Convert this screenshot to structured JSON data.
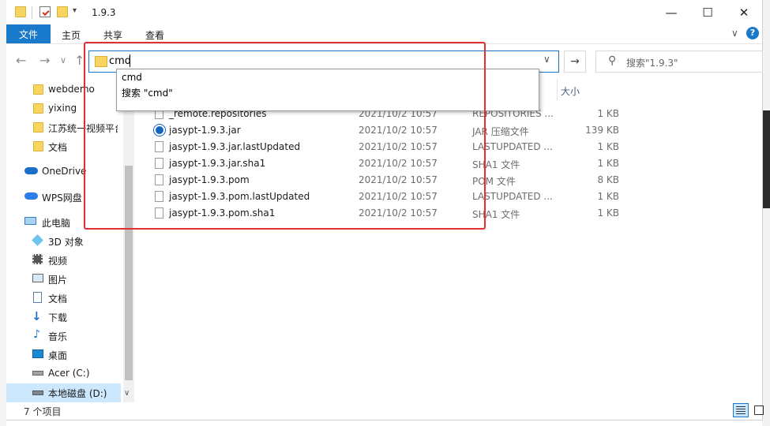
{
  "window": {
    "title": "1.9.3",
    "controls": {
      "minimize": "—",
      "maximize": "☐",
      "close": "✕"
    }
  },
  "ribbon": {
    "tabs": [
      "文件",
      "主页",
      "共享",
      "查看"
    ],
    "help": "?",
    "expand": "∨"
  },
  "nav": {
    "back": "←",
    "forward": "→",
    "recent": "∨",
    "up": "↑",
    "address_value": "cmd",
    "go": "→",
    "search_placeholder": "搜索\"1.9.3\""
  },
  "autocomplete": {
    "items": [
      "cmd",
      "搜索 \"cmd\""
    ]
  },
  "columns": {
    "size": "大小"
  },
  "sidebar": {
    "items": [
      {
        "label": "webdemo",
        "icon": "folder-icon"
      },
      {
        "label": "yixing",
        "icon": "folder-icon"
      },
      {
        "label": "江苏统一视频平台",
        "icon": "folder-icon"
      },
      {
        "label": "文档",
        "icon": "folder-icon"
      },
      {
        "label": "OneDrive",
        "icon": "cloud-icon"
      },
      {
        "label": "WPS网盘",
        "icon": "cloud-icon"
      },
      {
        "label": "此电脑",
        "icon": "computer-icon"
      },
      {
        "label": "3D 对象",
        "icon": "cube-icon"
      },
      {
        "label": "视频",
        "icon": "video-icon"
      },
      {
        "label": "图片",
        "icon": "picture-icon"
      },
      {
        "label": "文档",
        "icon": "document-icon"
      },
      {
        "label": "下载",
        "icon": "download-icon"
      },
      {
        "label": "音乐",
        "icon": "music-icon"
      },
      {
        "label": "桌面",
        "icon": "desktop-icon"
      },
      {
        "label": "Acer (C:)",
        "icon": "drive-icon"
      },
      {
        "label": "本地磁盘 (D:)",
        "icon": "drive-icon"
      }
    ]
  },
  "files": [
    {
      "name": "_remote.repositories",
      "date": "2021/10/2 10:57",
      "type": "REPOSITORIES ...",
      "size": "1 KB",
      "icon": "document-icon"
    },
    {
      "name": "jasypt-1.9.3.jar",
      "date": "2021/10/2 10:57",
      "type": "JAR 压缩文件",
      "size": "139 KB",
      "icon": "jar-icon"
    },
    {
      "name": "jasypt-1.9.3.jar.lastUpdated",
      "date": "2021/10/2 10:57",
      "type": "LASTUPDATED ...",
      "size": "1 KB",
      "icon": "document-icon"
    },
    {
      "name": "jasypt-1.9.3.jar.sha1",
      "date": "2021/10/2 10:57",
      "type": "SHA1 文件",
      "size": "1 KB",
      "icon": "document-icon"
    },
    {
      "name": "jasypt-1.9.3.pom",
      "date": "2021/10/2 10:57",
      "type": "POM 文件",
      "size": "8 KB",
      "icon": "document-icon"
    },
    {
      "name": "jasypt-1.9.3.pom.lastUpdated",
      "date": "2021/10/2 10:57",
      "type": "LASTUPDATED ...",
      "size": "1 KB",
      "icon": "document-icon"
    },
    {
      "name": "jasypt-1.9.3.pom.sha1",
      "date": "2021/10/2 10:57",
      "type": "SHA1 文件",
      "size": "1 KB",
      "icon": "document-icon"
    }
  ],
  "status": {
    "item_count": "7 个项目"
  },
  "colors": {
    "accent": "#1979ca",
    "selection": "#cce8ff",
    "annotation": "#e03030"
  }
}
